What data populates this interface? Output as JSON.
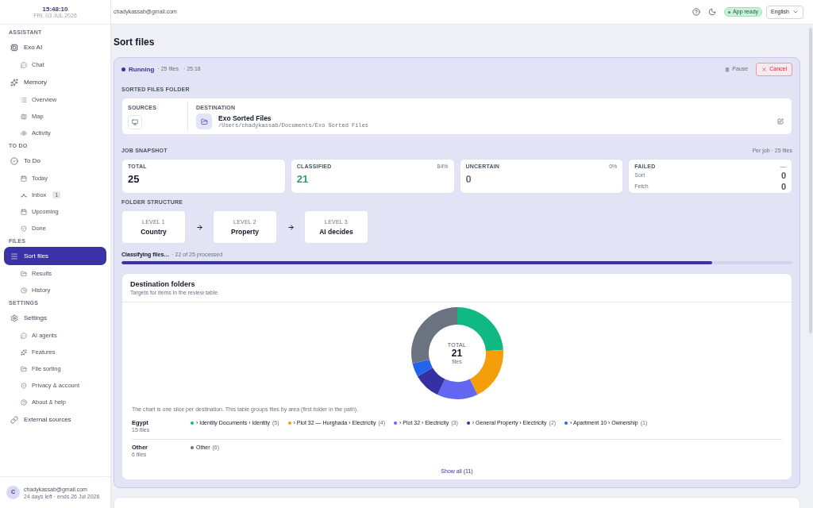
{
  "sidebar": {
    "clock": {
      "time": "15:48:10",
      "date": "FRI, 03 JUL 2026"
    },
    "sections": [
      {
        "title": "ASSISTANT",
        "items": [
          {
            "label": "Exo AI",
            "selected": false,
            "children": [
              {
                "label": "Chat",
                "selected": false
              }
            ]
          },
          {
            "label": "Memory",
            "selected": false,
            "children": [
              {
                "label": "Overview",
                "selected": false
              },
              {
                "label": "Map",
                "selected": false
              },
              {
                "label": "Activity",
                "selected": false
              }
            ]
          }
        ]
      },
      {
        "title": "TO DO",
        "items": [
          {
            "label": "To Do",
            "selected": false,
            "children": [
              {
                "label": "Today",
                "selected": false
              },
              {
                "label": "Inbox",
                "selected": false,
                "badge": "1"
              },
              {
                "label": "Upcoming",
                "selected": false
              },
              {
                "label": "Done",
                "selected": false
              }
            ]
          }
        ]
      },
      {
        "title": "FILES",
        "items": [
          {
            "label": "Sort files",
            "selected": true,
            "children": [
              {
                "label": "Results",
                "selected": false
              },
              {
                "label": "History",
                "selected": false
              }
            ]
          }
        ]
      },
      {
        "title": "SETTINGS",
        "items": [
          {
            "label": "Settings",
            "selected": false,
            "children": [
              {
                "label": "AI agents",
                "selected": false
              },
              {
                "label": "Features",
                "selected": false
              },
              {
                "label": "File sorting",
                "selected": false
              },
              {
                "label": "Privacy & account",
                "selected": false
              },
              {
                "label": "About & help",
                "selected": false
              }
            ]
          },
          {
            "label": "External sources",
            "selected": false
          }
        ]
      }
    ],
    "user": {
      "initial": "C",
      "email": "chadykassab@gmail.com",
      "plan": "24 days left · ends 26 Jul 2026"
    }
  },
  "top_bar": {
    "email": "chadykassab@gmail.com",
    "status_badge": "App ready",
    "language": "English"
  },
  "page_title": "Sort files",
  "job": {
    "status": "Running",
    "files": "· 25 files",
    "elapsed": "· 25:18",
    "buttons": [
      {
        "kind": "pause",
        "label": "Pause"
      },
      {
        "kind": "cancel",
        "label": "Cancel"
      }
    ],
    "sorted_files_folder": {
      "heading": "SORTED FILES FOLDER",
      "sources_label": "SOURCES",
      "destination_label": "DESTINATION",
      "destination_name": "Exo Sorted Files",
      "destination_path": "/Users/chadykassab/Documents/Exo Sorted Files"
    },
    "snapshot": {
      "heading": "JOB SNAPSHOT",
      "note": "Per job · 25 files",
      "cards": [
        {
          "kind": "count",
          "label": "TOTAL",
          "value": "25",
          "color": "#111827"
        },
        {
          "kind": "count",
          "label": "CLASSIFIED",
          "share": "84%",
          "value": "21",
          "color": "#2f9e5b"
        },
        {
          "kind": "count",
          "label": "UNCERTAIN",
          "share": "0%",
          "value": "0",
          "color": "#6b7280"
        },
        {
          "kind": "breakdown",
          "label": "FAILED",
          "share": "—",
          "rows": [
            {
              "label": "Sort",
              "value": "0"
            },
            {
              "label": "Fetch",
              "value": "0"
            }
          ]
        }
      ]
    },
    "folder_structure": {
      "heading": "FOLDER STRUCTURE",
      "levels": [
        {
          "label": "LEVEL 1",
          "value": "Country"
        },
        {
          "label": "LEVEL 2",
          "value": "Property"
        },
        {
          "label": "LEVEL 3",
          "value": "AI decides"
        }
      ]
    },
    "progress": {
      "label": "Classifying files…",
      "detail": "· 22 of 25 processed",
      "level": 0.88
    },
    "destination_folders": {
      "title": "Destination folders",
      "subtitle": "Targets for items in the review table.",
      "chart_data": {
        "type": "donut",
        "values": [
          23.8,
          19.0,
          14.3,
          9.5,
          4.8,
          28.6
        ]
      },
      "center": {
        "label": "TOTAL",
        "value": "21",
        "unit": "files"
      },
      "note": "The chart is one slice per destination. This table groups files by area (first folder in the path).",
      "groups": [
        {
          "name": "Egypt",
          "count": "15 files",
          "entries": [
            {
              "path": "› Identity Documents › Identity",
              "count": "(5)",
              "color": "#10b981"
            },
            {
              "path": "› Plot 32 — Hurghada › Electricity",
              "count": "(4)",
              "color": "#f59e0b"
            },
            {
              "path": "› Plot 32 › Electricity",
              "count": "(3)",
              "color": "#6366f1"
            },
            {
              "path": "› General Property › Electricity",
              "count": "(2)",
              "color": "#3730a3"
            },
            {
              "path": "› Apartment 10 › Ownership",
              "count": "(1)",
              "color": "#2563eb"
            }
          ]
        },
        {
          "name": "Other",
          "count": "6 files",
          "entries": [
            {
              "path": "Other",
              "count": "(6)",
              "color": "#6b7280"
            }
          ]
        }
      ],
      "show_all": "Show all (11)"
    }
  }
}
